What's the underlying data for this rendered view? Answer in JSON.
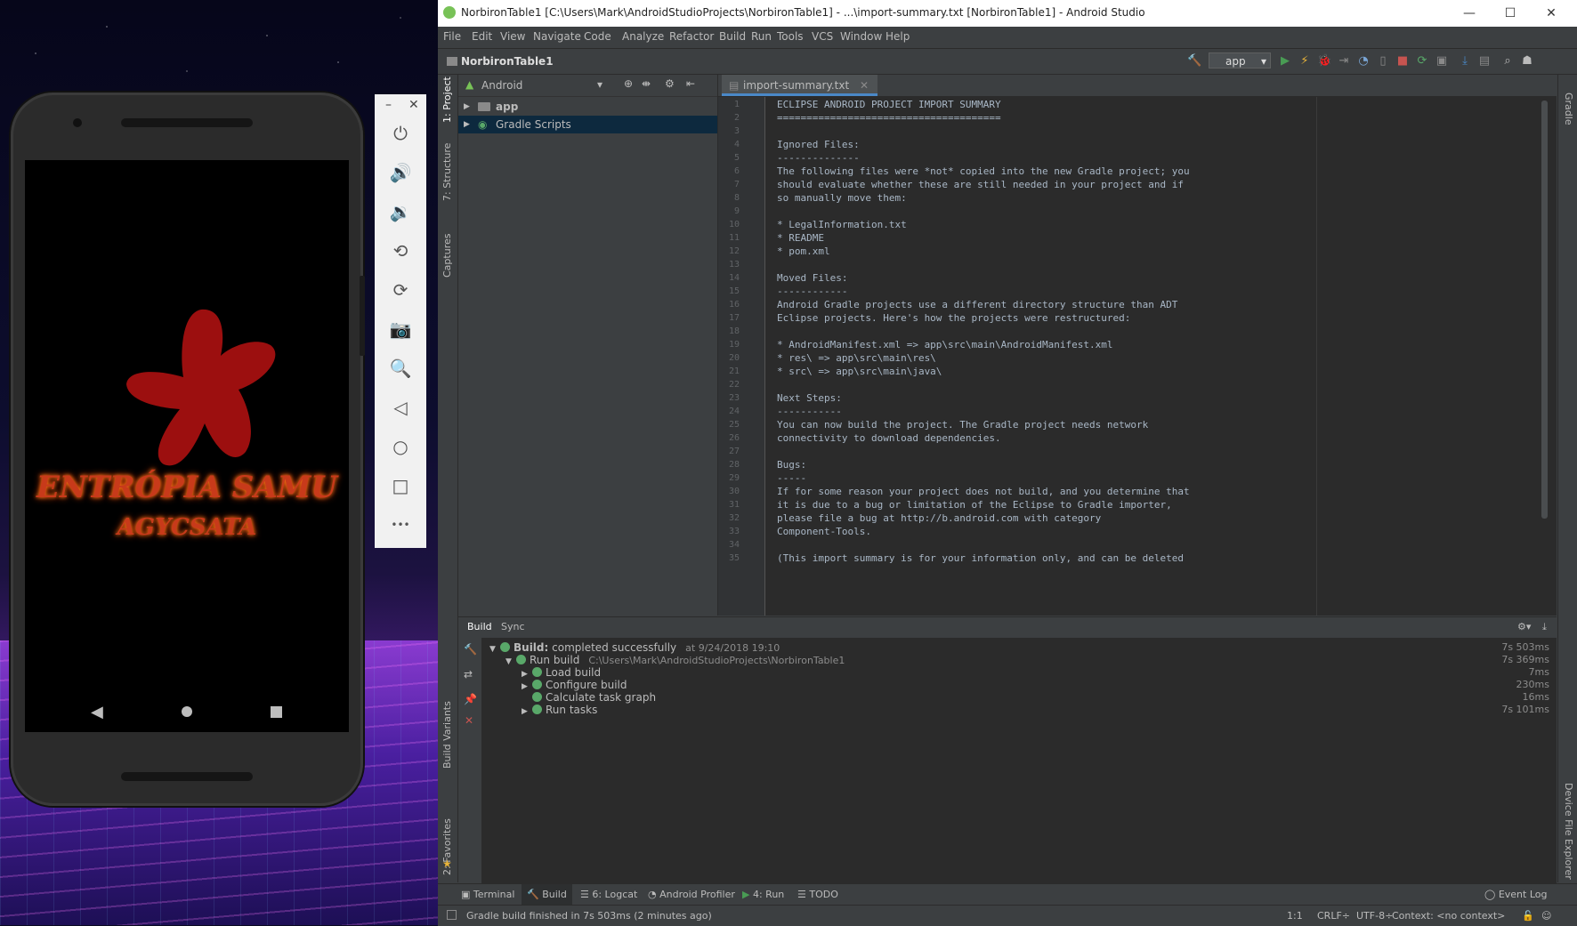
{
  "emulator": {
    "splash_title": "ENTRÓPIA SAMU",
    "splash_subtitle": "AGYCSATA",
    "window_minimize": "–",
    "window_close": "✕",
    "toolbar_more": "•••"
  },
  "studio": {
    "window_title": "NorbironTable1 [C:\\Users\\Mark\\AndroidStudioProjects\\NorbironTable1] - ...\\import-summary.txt [NorbironTable1] - Android Studio",
    "menu": [
      "File",
      "Edit",
      "View",
      "Navigate",
      "Code",
      "Analyze",
      "Refactor",
      "Build",
      "Run",
      "Tools",
      "VCS",
      "Window",
      "Help"
    ],
    "project_name": "NorbironTable1",
    "run_config": "app",
    "left_tabs": [
      "1: Project",
      "7: Structure",
      "Captures",
      "Build Variants",
      "2: Favorites"
    ],
    "right_tabs": [
      "Gradle",
      "Device File Explorer"
    ],
    "project_view": "Android",
    "tree": [
      {
        "label": "app",
        "bold": true
      },
      {
        "label": "Gradle Scripts",
        "bold": false
      }
    ],
    "editor_tab": "import-summary.txt",
    "code_lines": [
      "ECLIPSE ANDROID PROJECT IMPORT SUMMARY",
      "======================================",
      "",
      "Ignored Files:",
      "--------------",
      "The following files were *not* copied into the new Gradle project; you",
      "should evaluate whether these are still needed in your project and if",
      "so manually move them:",
      "",
      "* LegalInformation.txt",
      "* README",
      "* pom.xml",
      "",
      "Moved Files:",
      "------------",
      "Android Gradle projects use a different directory structure than ADT",
      "Eclipse projects. Here's how the projects were restructured:",
      "",
      "* AndroidManifest.xml => app\\src\\main\\AndroidManifest.xml",
      "* res\\ => app\\src\\main\\res\\",
      "* src\\ => app\\src\\main\\java\\",
      "",
      "Next Steps:",
      "-----------",
      "You can now build the project. The Gradle project needs network",
      "connectivity to download dependencies.",
      "",
      "Bugs:",
      "-----",
      "If for some reason your project does not build, and you determine that",
      "it is due to a bug or limitation of the Eclipse to Gradle importer,",
      "please file a bug at http://b.android.com with category",
      "Component-Tools.",
      "",
      "(This import summary is for your information only, and can be deleted"
    ],
    "build": {
      "tabs": [
        "Build",
        "Sync"
      ],
      "rows": [
        {
          "indent": 0,
          "expanded": true,
          "label": "Build:",
          "label2": " completed successfully",
          "extra": "at 9/24/2018 19:10",
          "duration": "7s 503ms"
        },
        {
          "indent": 1,
          "expanded": true,
          "label": "Run build",
          "label2": "",
          "extra": "C:\\Users\\Mark\\AndroidStudioProjects\\NorbironTable1",
          "duration": "7s 369ms"
        },
        {
          "indent": 2,
          "expanded": false,
          "label": "Load build",
          "label2": "",
          "extra": "",
          "duration": "7ms"
        },
        {
          "indent": 2,
          "expanded": false,
          "label": "Configure build",
          "label2": "",
          "extra": "",
          "duration": "230ms"
        },
        {
          "indent": 2,
          "expanded": null,
          "label": "Calculate task graph",
          "label2": "",
          "extra": "",
          "duration": "16ms"
        },
        {
          "indent": 2,
          "expanded": false,
          "label": "Run tasks",
          "label2": "",
          "extra": "",
          "duration": "7s 101ms"
        }
      ]
    },
    "bottom_tabs": [
      "Terminal",
      "Build",
      "6: Logcat",
      "Android Profiler",
      "4: Run",
      "TODO"
    ],
    "event_log": "Event Log",
    "status": {
      "message": "Gradle build finished in 7s 503ms (2 minutes ago)",
      "position": "1:1",
      "line_sep": "CRLF÷",
      "encoding": "UTF-8÷",
      "context": "Context: <no context>"
    },
    "colors": {
      "accent": "#4a88c7",
      "success": "#59a869",
      "run": "#499c54",
      "stop": "#c75450"
    }
  }
}
